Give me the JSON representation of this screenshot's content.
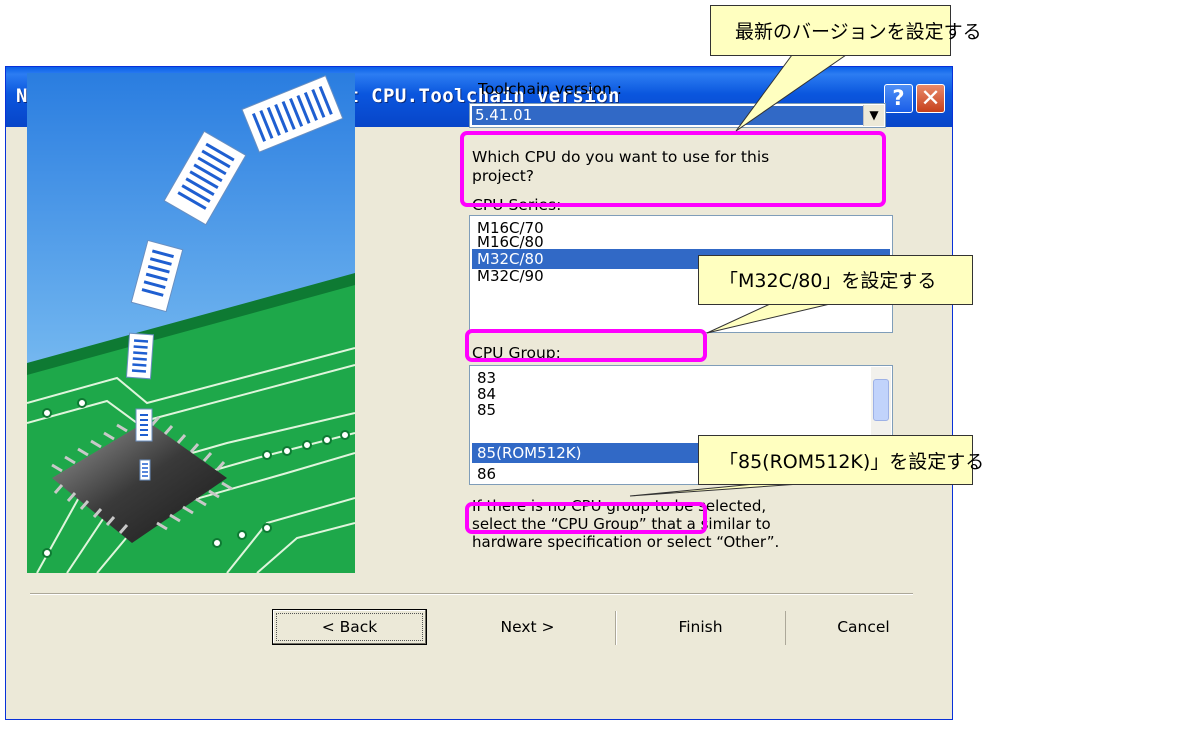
{
  "window": {
    "title": "New Project-1/6-Select Target CPU.Toolchain version",
    "help_glyph": "?",
    "close_glyph": "✕"
  },
  "toolchain": {
    "label": "Toolchain version :",
    "value": "5.41.01"
  },
  "question": {
    "line1": "Which CPU do you want to use for this",
    "line2": "project?"
  },
  "cpu_series": {
    "label": "CPU Series:",
    "items": [
      "M16C/70",
      "M16C/80",
      "M32C/80",
      "M32C/90"
    ],
    "selected": "M32C/80"
  },
  "cpu_group": {
    "label": "CPU Group:",
    "items": [
      "83",
      "84",
      "85",
      "85(ROM512K)",
      "86"
    ],
    "selected": "85(ROM512K)"
  },
  "hint": {
    "line1": "If there is no CPU group to be selected,",
    "line2": "select the “CPU Group” that a similar to",
    "line3": "hardware specification or select “Other”."
  },
  "buttons": {
    "back": "< Back",
    "next": "Next >",
    "finish": "Finish",
    "cancel": "Cancel"
  },
  "callouts": {
    "toolchain": "最新のバージョンを設定する",
    "series": "「M32C/80」を設定する",
    "group": "「85(ROM512K)」を設定する"
  },
  "colors": {
    "title_bar": "#0a56de",
    "selection": "#3169c6",
    "highlight": "#ff00ff",
    "callout_fill": "#ffffc0",
    "dialog_bg": "#ece9d8"
  }
}
